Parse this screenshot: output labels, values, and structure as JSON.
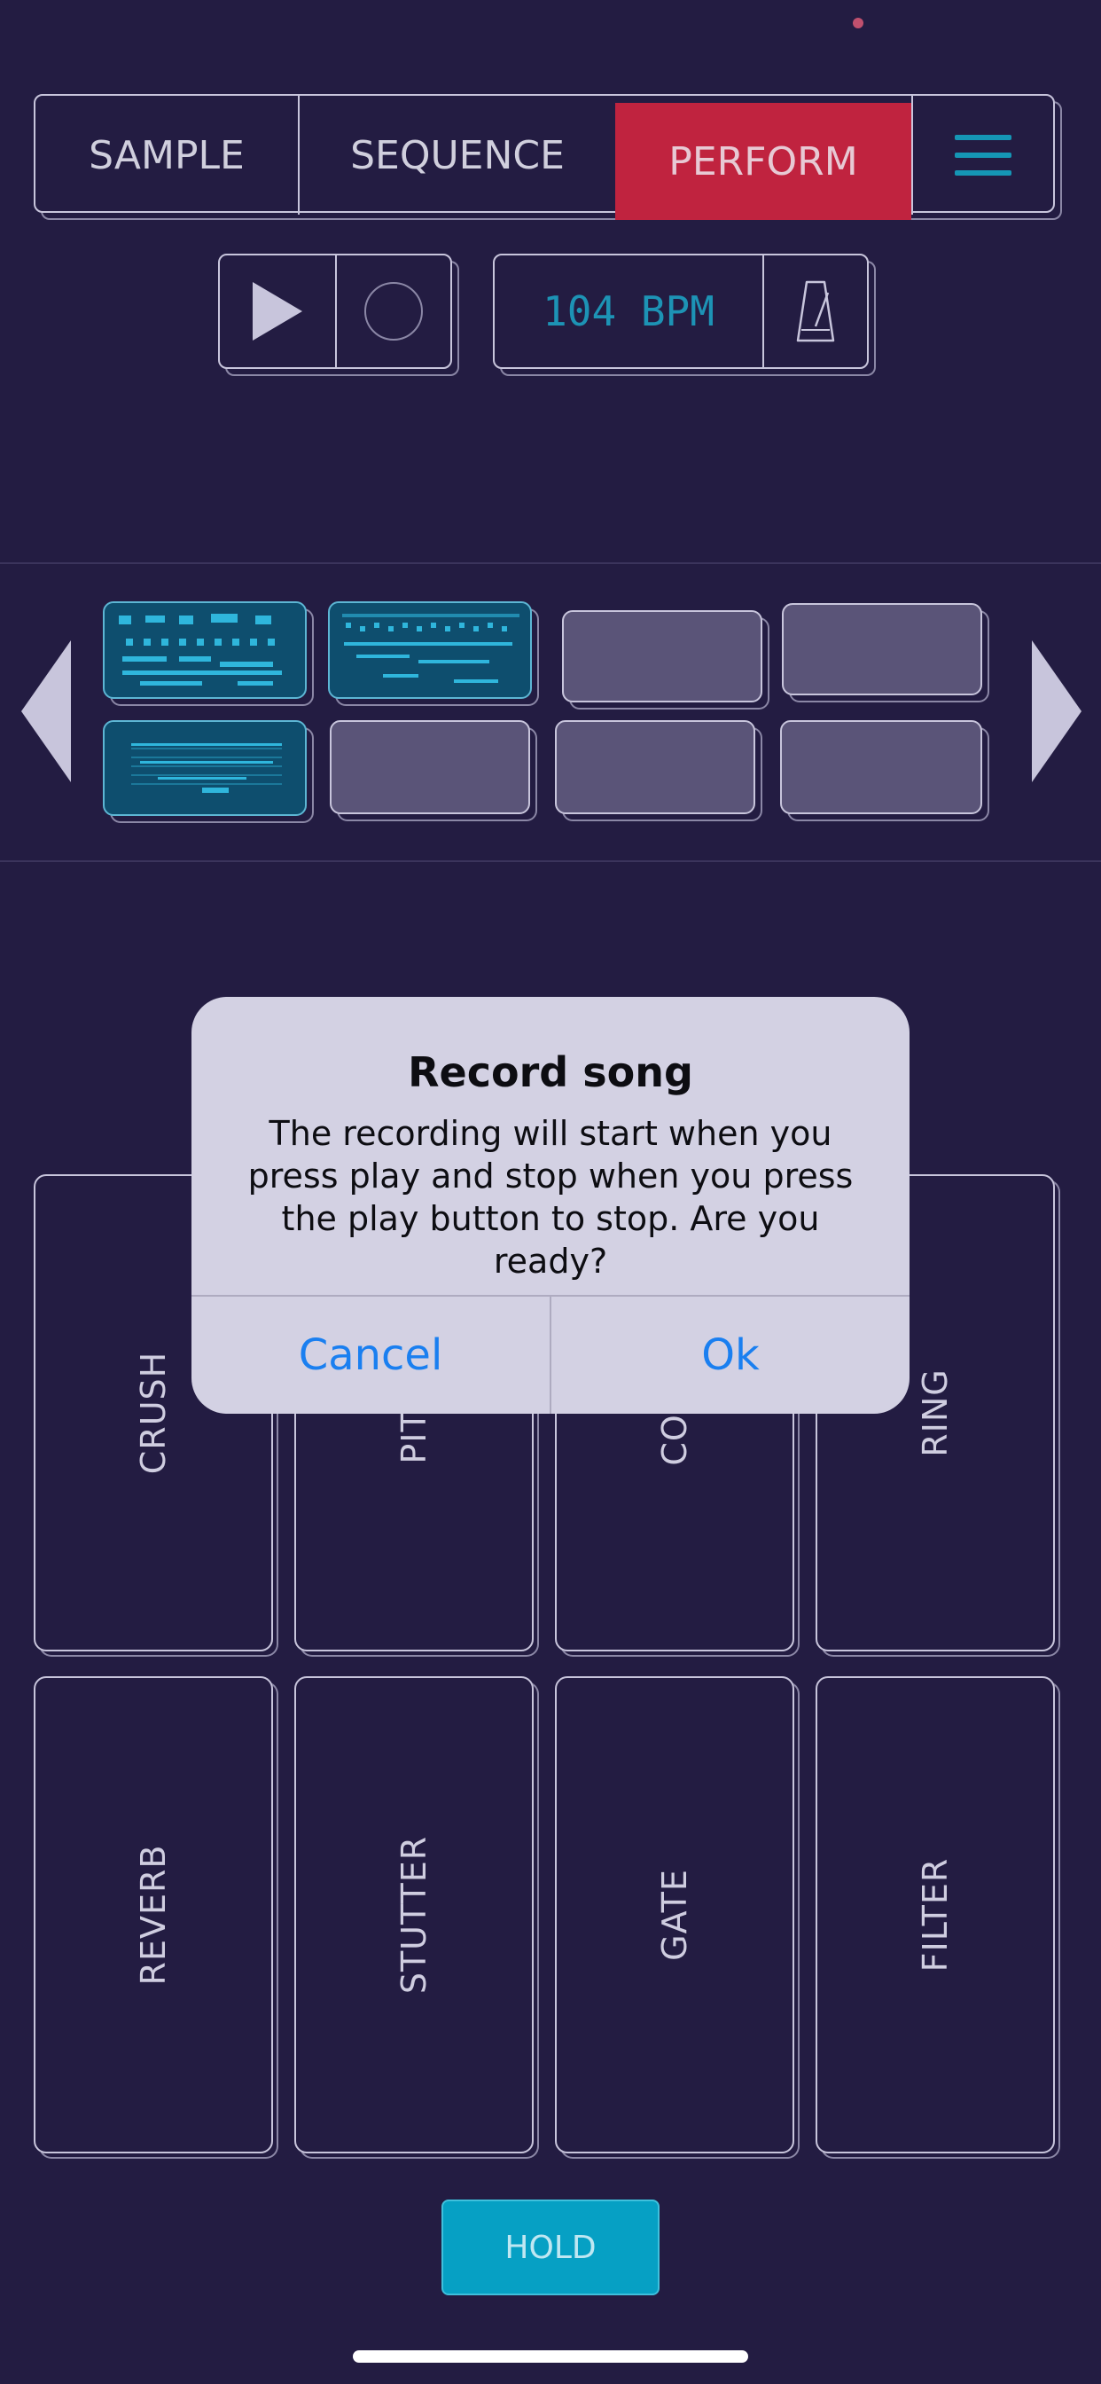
{
  "nav": {
    "sample": "SAMPLE",
    "sequence": "SEQUENCE",
    "perform": "PERFORM"
  },
  "transport": {
    "tempo": "104 BPM"
  },
  "effects": {
    "row1": [
      "CRUSH",
      "PITCH",
      "COMB",
      "RING"
    ],
    "row2": [
      "REVERB",
      "STUTTER",
      "GATE",
      "FILTER"
    ]
  },
  "hold_label": "HOLD",
  "dialog": {
    "title": "Record song",
    "message": "The recording will start when you press play and stop when you press the play button to stop. Are you ready?",
    "cancel": "Cancel",
    "ok": "Ok"
  },
  "colors": {
    "accent": "#c0233f",
    "cyan": "#1596b5",
    "background": "#231c42",
    "dialog_button": "#1a7ff0"
  },
  "icons": [
    "play-icon",
    "record-icon",
    "metronome-icon",
    "menu-icon",
    "arrow-left-icon",
    "arrow-right-icon"
  ]
}
